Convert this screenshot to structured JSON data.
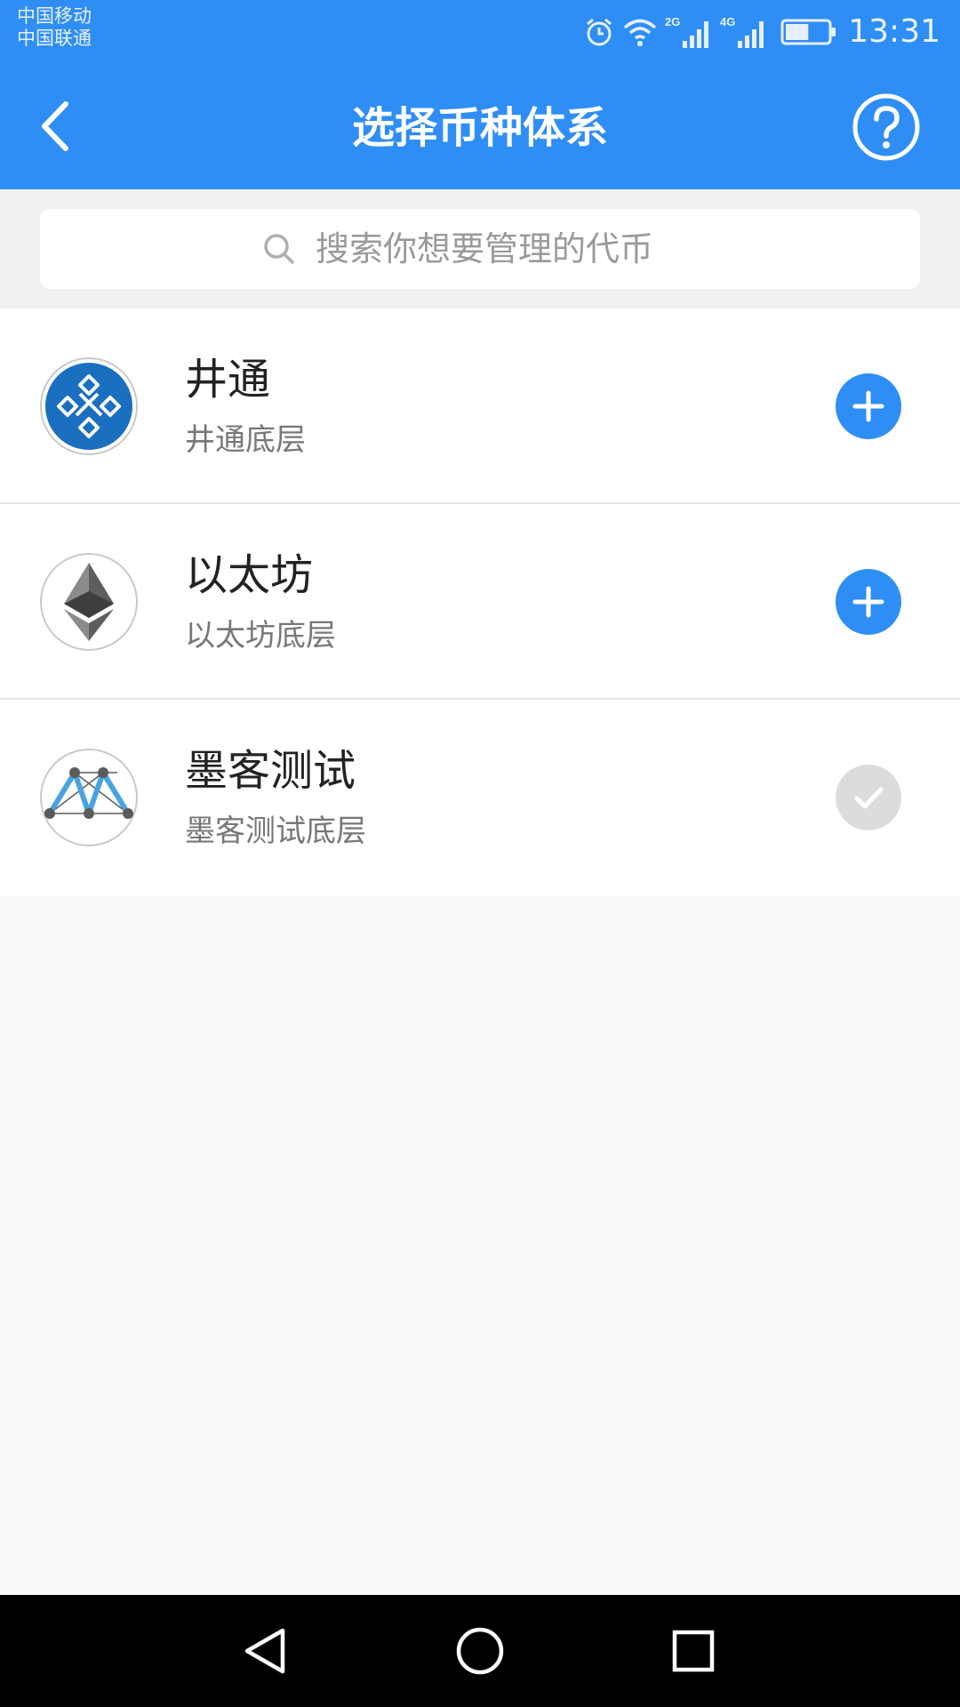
{
  "status_bar": {
    "carrier_1": "中国移动",
    "carrier_2": "中国联通",
    "network_1": "2G",
    "network_2": "4G",
    "time": "13:31",
    "battery_percent": 55
  },
  "app_bar": {
    "title": "选择币种体系",
    "back_icon": "chevron-left-icon",
    "help_icon": "question-circle-icon"
  },
  "search": {
    "placeholder": "搜索你想要管理的代币",
    "value": "",
    "icon": "search-icon"
  },
  "coins": [
    {
      "name": "井通",
      "subtitle": "井通底层",
      "logo": "jingtum-logo",
      "added": false
    },
    {
      "name": "以太坊",
      "subtitle": "以太坊底层",
      "logo": "ethereum-logo",
      "added": false
    },
    {
      "name": "墨客测试",
      "subtitle": "墨客测试底层",
      "logo": "moac-logo",
      "added": true
    }
  ],
  "colors": {
    "primary": "#2f8ef5",
    "added_button": "#dcdcdc",
    "jingtum_blue": "#1a6fc0"
  },
  "nav_bar": {
    "back_icon": "triangle-back-icon",
    "home_icon": "circle-home-icon",
    "recents_icon": "square-recents-icon"
  }
}
